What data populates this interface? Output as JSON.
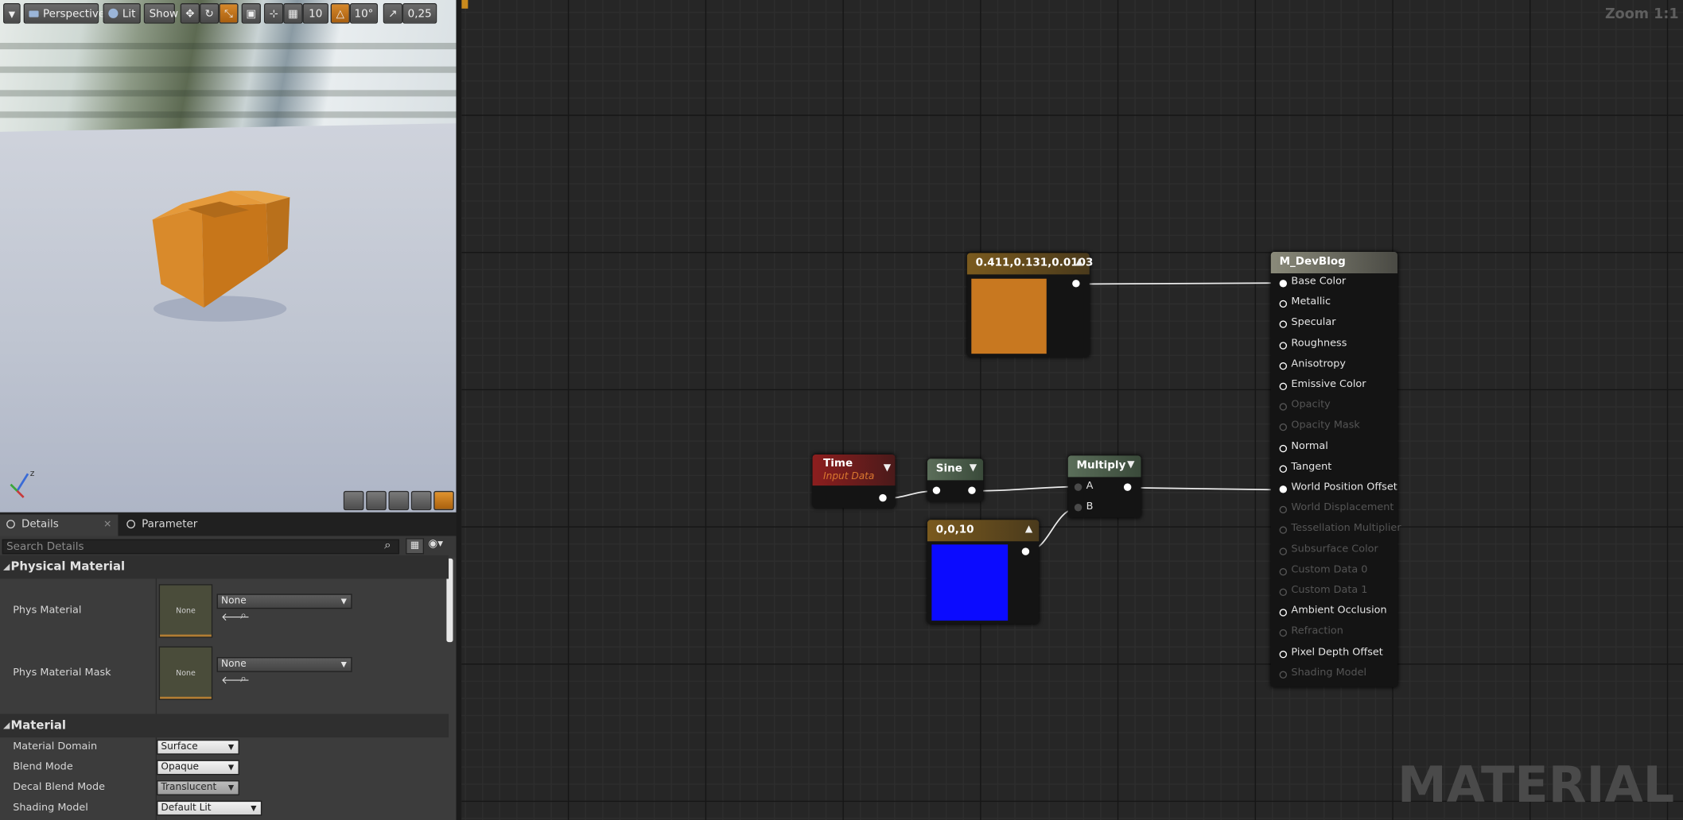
{
  "viewport": {
    "toolbar": {
      "perspective": "Perspective",
      "lit": "Lit",
      "show": "Show",
      "grid_snap": "10",
      "rotation_snap": "10°",
      "scale_snap": "0,25"
    }
  },
  "details": {
    "tabs": [
      "Details",
      "Parameter Defaults"
    ],
    "search_placeholder": "Search Details",
    "categories": {
      "physical_material": "Physical Material",
      "material": "Material"
    },
    "phys_material": {
      "label": "Phys Material",
      "thumb": "None",
      "value": "None"
    },
    "phys_material_mask": {
      "label": "Phys Material Mask",
      "thumb": "None",
      "value": "None"
    },
    "material_props": [
      {
        "label": "Material Domain",
        "value": "Surface"
      },
      {
        "label": "Blend Mode",
        "value": "Opaque"
      },
      {
        "label": "Decal Blend Mode",
        "value": "Translucent"
      },
      {
        "label": "Shading Model",
        "value": "Default Lit"
      }
    ]
  },
  "graph": {
    "zoom": "Zoom 1:1",
    "watermark": "MATERIAL",
    "nodes": {
      "constant_color": {
        "title": "0.411,0.131,0.0103",
        "color": "#c87820"
      },
      "time": {
        "title": "Time",
        "subtitle": "Input Data"
      },
      "sine": {
        "title": "Sine"
      },
      "multiply": {
        "title": "Multiply",
        "pins": [
          "A",
          "B"
        ]
      },
      "constant_vector": {
        "title": "0,0,10",
        "color": "#0b0bff"
      },
      "result": {
        "title": "M_DevBlog",
        "pins": [
          {
            "label": "Base Color",
            "enabled": true
          },
          {
            "label": "Metallic",
            "enabled": true
          },
          {
            "label": "Specular",
            "enabled": true
          },
          {
            "label": "Roughness",
            "enabled": true
          },
          {
            "label": "Anisotropy",
            "enabled": true
          },
          {
            "label": "Emissive Color",
            "enabled": true
          },
          {
            "label": "Opacity",
            "enabled": false
          },
          {
            "label": "Opacity Mask",
            "enabled": false
          },
          {
            "label": "Normal",
            "enabled": true
          },
          {
            "label": "Tangent",
            "enabled": true
          },
          {
            "label": "World Position Offset",
            "enabled": true
          },
          {
            "label": "World Displacement",
            "enabled": false
          },
          {
            "label": "Tessellation Multiplier",
            "enabled": false
          },
          {
            "label": "Subsurface Color",
            "enabled": false
          },
          {
            "label": "Custom Data 0",
            "enabled": false
          },
          {
            "label": "Custom Data 1",
            "enabled": false
          },
          {
            "label": "Ambient Occlusion",
            "enabled": true
          },
          {
            "label": "Refraction",
            "enabled": false
          },
          {
            "label": "Pixel Depth Offset",
            "enabled": true
          },
          {
            "label": "Shading Model",
            "enabled": false
          }
        ]
      }
    }
  }
}
